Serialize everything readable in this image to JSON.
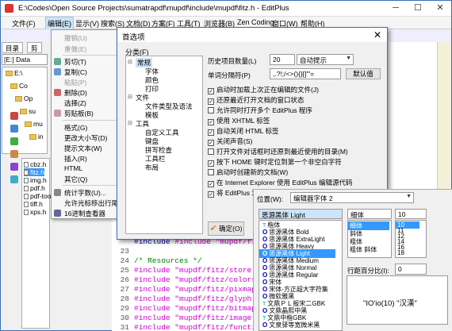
{
  "window": {
    "title": "E:\\Codes\\Open Source Projects\\sumatrapdf\\mupdf\\include\\mupdf\\fitz.h - EditPlus",
    "minimize": "─",
    "maximize": "☐",
    "close": "✕"
  },
  "menu": [
    "文件(F)",
    "编辑(E)",
    "显示(V)",
    "搜索(S)",
    "文档(D)",
    "方案(F)",
    "工具(T)",
    "浏览器(B)",
    "Zen Coding",
    "窗口(W)",
    "帮助(H)"
  ],
  "left_pane": {
    "tabs": [
      "目录",
      "剪"
    ],
    "drive": "[E:] Data",
    "tree": [
      "E:\\",
      "Co",
      "Op",
      "su",
      "mu",
      "in"
    ],
    "files": [
      "cbz.h",
      "fitz.h",
      "img.h",
      "pdf.h",
      "pdf-tools.",
      "tiff.h",
      "xps.h"
    ],
    "selected_file": "fitz.h"
  },
  "context_menu": {
    "items": [
      {
        "label": "撤销(U)",
        "disabled": true
      },
      {
        "label": "重做(E)",
        "disabled": true
      },
      {
        "label": "剪切(T)",
        "disabled": false
      },
      {
        "label": "复制(C)",
        "disabled": false
      },
      {
        "label": "粘贴(P)",
        "disabled": true
      },
      {
        "label": "删除(D)",
        "disabled": false
      },
      {
        "label": "选择(Z)",
        "disabled": false
      },
      {
        "label": "剪贴板(B)",
        "disabled": false
      },
      {
        "label": "格式(G)",
        "disabled": false
      },
      {
        "label": "更改大小写(D)",
        "disabled": false
      },
      {
        "label": "提示文本(W)",
        "disabled": false
      },
      {
        "label": "插入(R)",
        "disabled": false
      },
      {
        "label": "HTML",
        "disabled": false
      },
      {
        "label": "其它(Q)",
        "disabled": false
      },
      {
        "label": "统计字数(U)...",
        "disabled": false
      },
      {
        "label": "允许光标移出行尾(L)",
        "disabled": false
      },
      {
        "label": "16进制查看器",
        "disabled": false
      }
    ]
  },
  "editor": {
    "lines": [
      {
        "num": "",
        "text": "#include \"mupdf/fitz/buffer.h\""
      },
      {
        "num": "23",
        "text": ""
      },
      {
        "num": "24",
        "text": "/* Resources */"
      },
      {
        "num": "25",
        "text": "#include \"mupdf/fitz/store.h\""
      },
      {
        "num": "26",
        "text": "#include \"mupdf/fitz/colorspace.h\""
      },
      {
        "num": "27",
        "text": "#include \"mupdf/fitz/pixmap.h\""
      },
      {
        "num": "28",
        "text": "#include \"mupdf/fitz/glyph.h\""
      },
      {
        "num": "29",
        "text": "#include \"mupdf/fitz/bitmap.h\""
      },
      {
        "num": "30",
        "text": "#include \"mupdf/fitz/image.h\""
      },
      {
        "num": "31",
        "text": "#include \"mupdf/fitz/function.h\""
      }
    ]
  },
  "prefs": {
    "title": "首选项",
    "close": "✕",
    "category_label": "分类(F)",
    "categories": [
      {
        "label": "常规",
        "level": 0,
        "selected": true,
        "toggle": "⊟"
      },
      {
        "label": "字体",
        "level": 1
      },
      {
        "label": "颜色",
        "level": 1
      },
      {
        "label": "打印",
        "level": 1
      },
      {
        "label": "文件",
        "level": 0,
        "toggle": "⊟"
      },
      {
        "label": "文件类型及语法",
        "level": 1
      },
      {
        "label": "模板",
        "level": 1
      },
      {
        "label": "工具",
        "level": 0,
        "toggle": "⊟"
      },
      {
        "label": "自定义工具",
        "level": 1
      },
      {
        "label": "键盘",
        "level": 1
      },
      {
        "label": "拼写检查",
        "level": 1
      },
      {
        "label": "工具栏",
        "level": 1
      },
      {
        "label": "布局",
        "level": 1
      }
    ],
    "history_label": "历史项目数量(L)",
    "history_value": "20",
    "hint_value": "自动提示",
    "word_sep_label": "单词分隔符(P)",
    "word_sep_value": ",.?!;/<>(){}[]\"'=",
    "default_button": "默认值",
    "options": [
      {
        "label": "启动时加载上次正在编辑的文件(J)",
        "checked": true
      },
      {
        "label": "还原最近打开文档的窗口状态",
        "checked": true
      },
      {
        "label": "允许同时打开多个 EditPlus 程序",
        "checked": false
      },
      {
        "label": "使用 XHTML 标签",
        "checked": true
      },
      {
        "label": "自动关闭 HTML 标签",
        "checked": true
      },
      {
        "label": "关闭声音(S)",
        "checked": true
      },
      {
        "label": "打开文件对话框时还原到最近使用的目录(M)",
        "checked": false
      },
      {
        "label": "按下 HOME 键时定位到第一个非空白字符",
        "checked": true
      },
      {
        "label": "启动时创建新的文档(W)",
        "checked": false
      },
      {
        "label": "在 Internet Explorer 使用 EditPlus 编辑源代码",
        "checked": true
      },
      {
        "label": "将 EditPlus 添加到系统右键菜单",
        "checked": true
      }
    ],
    "ok_check": "✔",
    "ok_label": "确定(O)"
  },
  "font_panel": {
    "position_label": "位置(W):",
    "position_value": "编辑器字体 2",
    "font_input": "思源黑体 Light",
    "style_input": "细体",
    "size_input": "10",
    "fonts": [
      {
        "name": "楷体",
        "icon": "T"
      },
      {
        "name": "思源黑体 Bold",
        "icon": "O"
      },
      {
        "name": "思源黑体 ExtraLight",
        "icon": "O"
      },
      {
        "name": "思源黑体 Heavy",
        "icon": "O"
      },
      {
        "name": "思源黑体 Light",
        "icon": "O",
        "selected": true
      },
      {
        "name": "思源黑体 Medium",
        "icon": "O"
      },
      {
        "name": "思源黑体 Normal",
        "icon": "O"
      },
      {
        "name": "思源黑体 Regular",
        "icon": "O"
      },
      {
        "name": "宋体",
        "icon": "O"
      },
      {
        "name": "宋体-方正超大字符集",
        "icon": "O"
      },
      {
        "name": "微软雅黑",
        "icon": "O"
      },
      {
        "name": "文鼎ＰＬ报宋二GBK",
        "icon": "T"
      },
      {
        "name": "文鼎晶熙中黑",
        "icon": "O"
      },
      {
        "name": "文鼎中楷GBK",
        "icon": "T"
      },
      {
        "name": "文泉驿等宽微米黑",
        "icon": "O"
      }
    ],
    "styles": [
      {
        "name": "细体",
        "selected": true
      },
      {
        "name": "斜体"
      },
      {
        "name": "粗体"
      },
      {
        "name": "粗体 斜体"
      }
    ],
    "sizes": [
      {
        "name": "10",
        "selected": true
      },
      {
        "name": "11"
      },
      {
        "name": "12"
      },
      {
        "name": "14"
      },
      {
        "name": "16"
      },
      {
        "name": "18"
      }
    ],
    "line_spacing_label": "行距百分比(I):",
    "line_spacing_value": "0",
    "preview_text": "\"IO'io(10) \"汉漢\""
  }
}
